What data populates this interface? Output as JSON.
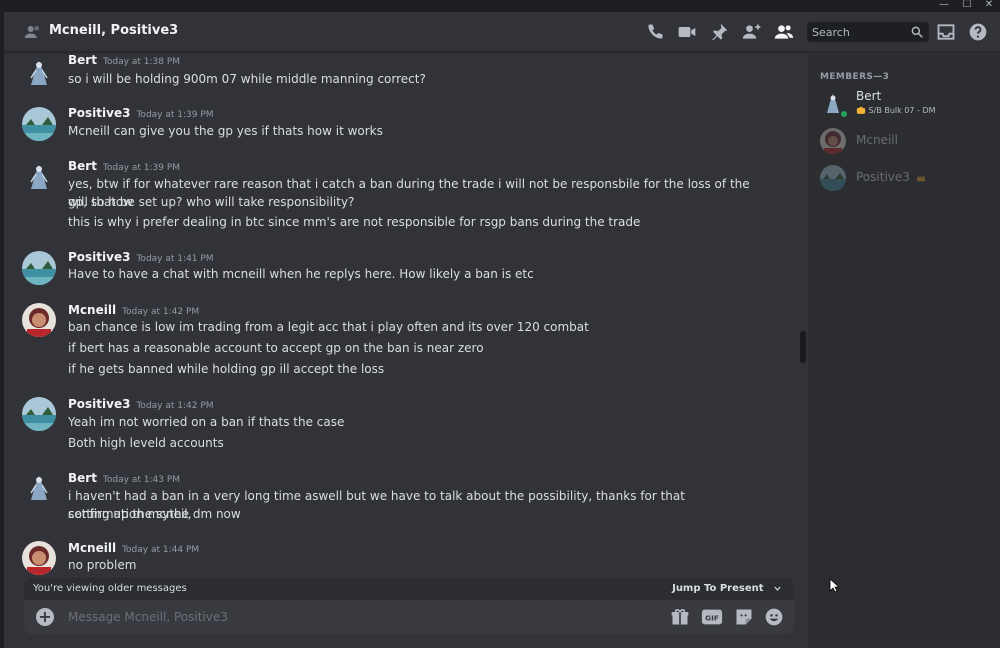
{
  "window": {
    "controls": [
      "—",
      "☐",
      "✕"
    ]
  },
  "header": {
    "title": "Mcneill, Positive3",
    "search_placeholder": "Search"
  },
  "messages": [
    {
      "author": "Bert",
      "timestamp": "Today at 1:38 PM",
      "lines": [
        "so i will be holding 900m 07 while middle manning correct?"
      ]
    },
    {
      "author": "Positive3",
      "timestamp": "Today at 1:39 PM",
      "lines": [
        "Mcneill can give you the gp yes if thats how it works"
      ]
    },
    {
      "author": "Bert",
      "timestamp": "Today at 1:39 PM",
      "lines": [
        "yes, btw if for whatever rare reason that i catch a ban during the trade i will not be responsbile for the loss of the gp, so how",
        "will that be set up? who will take responsibility?",
        "this is why i prefer dealing in btc since mm's are not responsible for rsgp bans during the trade"
      ]
    },
    {
      "author": "Positive3",
      "timestamp": "Today at 1:41 PM",
      "lines": [
        "Have to have a chat with mcneill when he replys here. How likely a ban is etc"
      ]
    },
    {
      "author": "Mcneill",
      "timestamp": "Today at 1:42 PM",
      "lines": [
        "ban chance is low im trading from a legit acc that i play often and its over 120 combat",
        "if bert has a reasonable account to accept gp on the ban is near zero",
        "if he gets banned while holding gp ill accept the loss"
      ]
    },
    {
      "author": "Positive3",
      "timestamp": "Today at 1:42 PM",
      "lines": [
        "Yeah im not worried on a ban if thats the case",
        "Both high leveld accounts"
      ]
    },
    {
      "author": "Bert",
      "timestamp": "Today at 1:43 PM",
      "lines": [
        "i haven't had a ban in a very long time aswell but we have to talk about the possibility, thanks for that confirmation mcneil,",
        "setting up the sythe dm now"
      ]
    },
    {
      "author": "Mcneill",
      "timestamp": "Today at 1:44 PM",
      "lines": [
        "no problem"
      ]
    }
  ],
  "older_bar": {
    "text": "You're viewing older messages",
    "jump_label": "Jump To Present"
  },
  "composer": {
    "placeholder": "Message Mcneill, Positive3",
    "gif_label": "GIF"
  },
  "members_panel": {
    "header": "MEMBERS—3",
    "members": [
      {
        "name": "Bert",
        "status": "S/B Bulk 07 - DM",
        "online": true
      },
      {
        "name": "Mcneill",
        "status": "",
        "online": false
      },
      {
        "name": "Positive3",
        "status": "",
        "online": false
      }
    ]
  },
  "colors": {
    "background": "#313338",
    "sidebar": "#2b2d31",
    "online": "#23a55a",
    "owner_crown": "#f0b232"
  }
}
